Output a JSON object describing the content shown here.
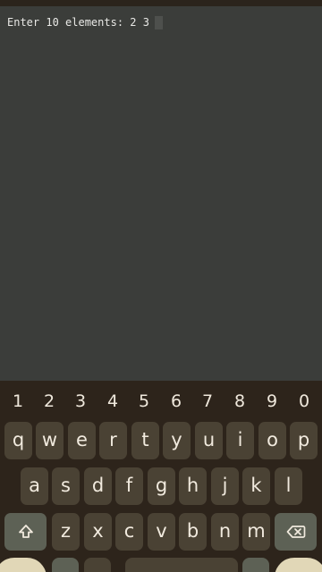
{
  "terminal": {
    "prompt": "Enter 10 elements: 2 3"
  },
  "keyboard": {
    "numbers": [
      "1",
      "2",
      "3",
      "4",
      "5",
      "6",
      "7",
      "8",
      "9",
      "0"
    ],
    "row1": [
      "q",
      "w",
      "e",
      "r",
      "t",
      "y",
      "u",
      "i",
      "o",
      "p"
    ],
    "row2": [
      "a",
      "s",
      "d",
      "f",
      "g",
      "h",
      "j",
      "k",
      "l"
    ],
    "row3": [
      "z",
      "x",
      "c",
      "v",
      "b",
      "n",
      "m"
    ],
    "icons": {
      "shift": "shift-arrow-icon",
      "delete": "backspace-icon"
    },
    "colors": {
      "key": "#4a4234",
      "function_key": "#5d6155",
      "background": "#2d241b",
      "text": "#f1eade"
    }
  }
}
